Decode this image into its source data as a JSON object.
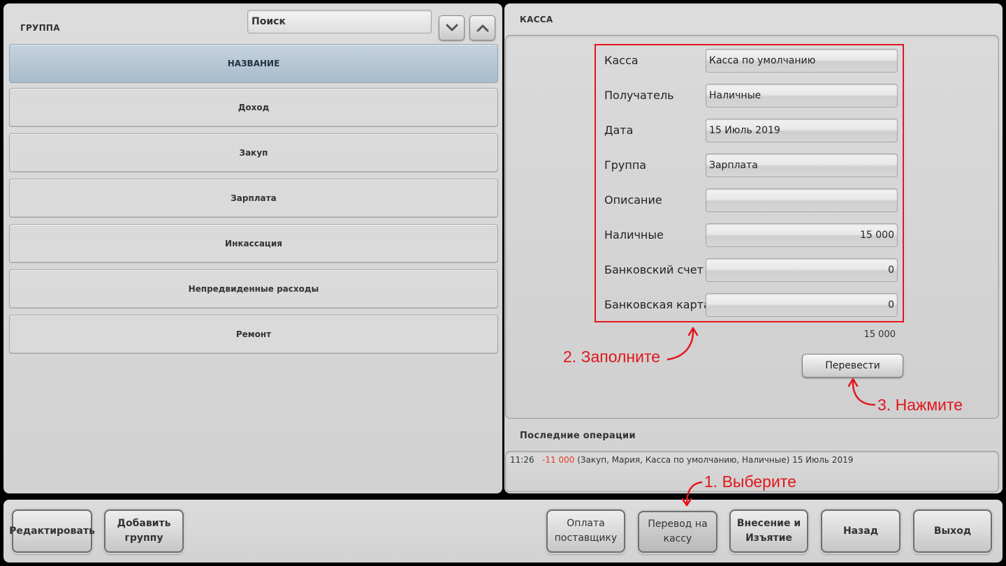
{
  "left": {
    "caption": "ГРУППА",
    "search_placeholder": "Поиск",
    "list_header": "НАЗВАНИЕ",
    "groups": [
      "Доход",
      "Закуп",
      "Зарплата",
      "Инкассация",
      "Непредвиденные расходы",
      "Ремонт"
    ]
  },
  "kassa": {
    "caption": "КАССА",
    "fields": [
      {
        "label": "Касса",
        "value": "Касса по умолчанию"
      },
      {
        "label": "Получатель",
        "value": "Наличные"
      },
      {
        "label": "Дата",
        "value": "15 Июль 2019"
      },
      {
        "label": "Группа",
        "value": "Зарплата"
      },
      {
        "label": "Описание",
        "value": ""
      },
      {
        "label": "Наличные",
        "value": "15 000"
      },
      {
        "label": "Банковский счет",
        "value": "0"
      },
      {
        "label": "Банковская карта",
        "value": "0"
      }
    ],
    "total": "15 000",
    "transfer_button": "Перевести"
  },
  "operations": {
    "caption": "Последние операции",
    "entry": {
      "time": "11:26",
      "amount": "-11 000",
      "details": "(Закуп, Мария, Касса по умолчанию, Наличные) 15 Июль 2019"
    }
  },
  "toolbar": {
    "edit": "Редактировать",
    "add_group_1": "Добавить",
    "add_group_2": "группу",
    "supplier_1": "Оплата",
    "supplier_2": "поставщику",
    "transfer_1": "Перевод на",
    "transfer_2": "кассу",
    "deposit_1": "Внесение и",
    "deposit_2": "Изъятие",
    "back": "Назад",
    "exit": "Выход"
  },
  "annotations": {
    "step1": "1. Выберите",
    "step2": "2. Заполните",
    "step3": "3. Нажмите"
  },
  "colors": {
    "annotation": "#e3161b",
    "negative_amount": "#e53a2a",
    "list_header": "#a8bccc"
  }
}
